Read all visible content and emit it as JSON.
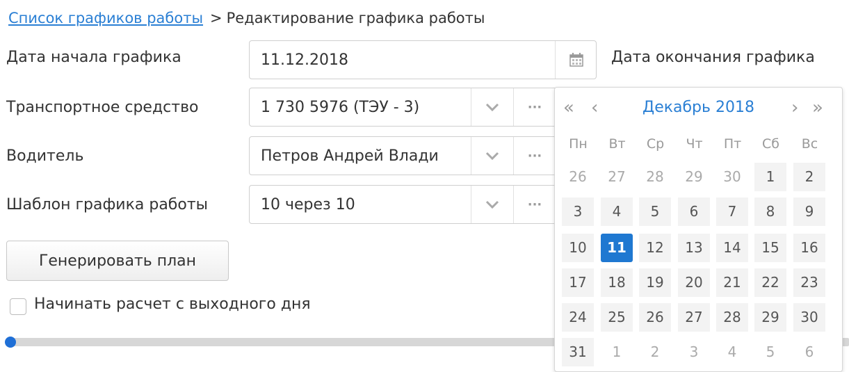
{
  "breadcrumb": {
    "link": "Список графиков работы",
    "separator": ">",
    "current": "Редактирование графика работы"
  },
  "form": {
    "start_date": {
      "label": "Дата начала графика",
      "value": "11.12.2018"
    },
    "end_date": {
      "label": "Дата окончания графика"
    },
    "vehicle": {
      "label": "Транспортное средство",
      "value": "1 730 5976 (ТЭУ - 3)"
    },
    "driver": {
      "label": "Водитель",
      "value": "Петров Андрей Влади"
    },
    "template": {
      "label": "Шаблон графика работы",
      "value": "10 через 10"
    },
    "generate_button": "Генерировать план",
    "weekend_checkbox": {
      "label": "Начинать расчет с выходного дня",
      "checked": false
    },
    "ellipsis": "···"
  },
  "slider": {
    "value": 0
  },
  "calendar": {
    "month_label": "Декабрь 2018",
    "nav": {
      "prev_year": "«",
      "prev_month": "‹",
      "next_month": "›",
      "next_year": "»"
    },
    "weekdays": [
      "Пн",
      "Вт",
      "Ср",
      "Чт",
      "Пт",
      "Сб",
      "Вс"
    ],
    "selected_day": "11",
    "weeks": [
      [
        "26",
        "27",
        "28",
        "29",
        "30",
        "1",
        "2"
      ],
      [
        "3",
        "4",
        "5",
        "6",
        "7",
        "8",
        "9"
      ],
      [
        "10",
        "11",
        "12",
        "13",
        "14",
        "15",
        "16"
      ],
      [
        "17",
        "18",
        "19",
        "20",
        "21",
        "22",
        "23"
      ],
      [
        "24",
        "25",
        "26",
        "27",
        "28",
        "29",
        "30"
      ],
      [
        "31",
        "1",
        "2",
        "3",
        "4",
        "5",
        "6"
      ]
    ],
    "other_month_mask": [
      [
        true,
        true,
        true,
        true,
        true,
        false,
        false
      ],
      [
        false,
        false,
        false,
        false,
        false,
        false,
        false
      ],
      [
        false,
        false,
        false,
        false,
        false,
        false,
        false
      ],
      [
        false,
        false,
        false,
        false,
        false,
        false,
        false
      ],
      [
        false,
        false,
        false,
        false,
        false,
        false,
        false
      ],
      [
        false,
        true,
        true,
        true,
        true,
        true,
        true
      ]
    ]
  },
  "colors": {
    "accent": "#1f78d1",
    "link": "#2a7fd4"
  }
}
